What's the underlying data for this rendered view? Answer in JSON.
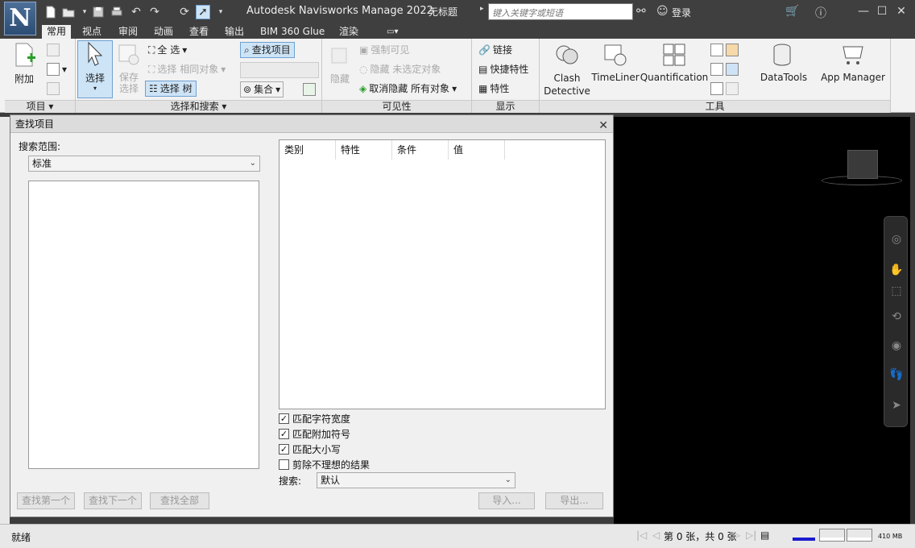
{
  "titlebar": {
    "logo": "N",
    "app_title": "Autodesk Navisworks Manage 2022",
    "doc_title": "无标题",
    "search_placeholder": "键入关键字或短语",
    "login": "登录"
  },
  "tabs": [
    {
      "label": "常用",
      "active": true
    },
    {
      "label": "视点"
    },
    {
      "label": "审阅"
    },
    {
      "label": "动画"
    },
    {
      "label": "查看"
    },
    {
      "label": "输出"
    },
    {
      "label": "BIM 360 Glue"
    },
    {
      "label": "渲染"
    }
  ],
  "ribbon": {
    "project": {
      "append": "附加",
      "label": "项目"
    },
    "select": {
      "select_btn": "选择",
      "save_select": "保存\n选择",
      "select_all": "全 选",
      "select_same": "选择 相同对象",
      "select_tree": "选择 树",
      "find_items": "查找项目",
      "sets": "集合",
      "label": "选择和搜索"
    },
    "visibility": {
      "hide": "隐藏",
      "require": "强制可见",
      "hide_unselected": "隐藏 未选定对象",
      "unhide_all": "取消隐藏 所有对象",
      "label": "可见性"
    },
    "display": {
      "links": "链接",
      "quick_props": "快捷特性",
      "properties": "特性",
      "label": "显示"
    },
    "tools": {
      "clash": "Clash\nDetective",
      "timeliner": "TimeLiner",
      "quantification": "Quantification",
      "datatools": "DataTools",
      "appmanager": "App Manager",
      "label": "工具"
    }
  },
  "dialog": {
    "title": "查找项目",
    "scope_label": "搜索范围:",
    "scope_value": "标准",
    "columns": [
      "类别",
      "特性",
      "条件",
      "值"
    ],
    "checkboxes": [
      {
        "label": "匹配字符宽度",
        "checked": true
      },
      {
        "label": "匹配附加符号",
        "checked": true
      },
      {
        "label": "匹配大小写",
        "checked": true
      },
      {
        "label": "剪除不理想的结果",
        "checked": false
      }
    ],
    "search_label": "搜索:",
    "search_value": "默认",
    "buttons": {
      "find_first": "查找第一个",
      "find_next": "查找下一个",
      "find_all": "查找全部",
      "import": "导入...",
      "export": "导出..."
    }
  },
  "status": {
    "text": "就绪",
    "sheet": "第 0 张，共 0 张",
    "memory": "410 MB"
  }
}
